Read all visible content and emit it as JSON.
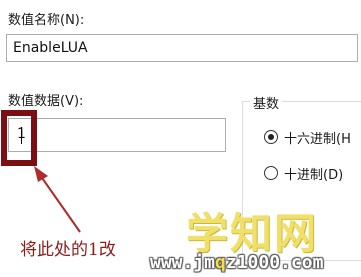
{
  "dialog": {
    "value_name_label": "数值名称(N):",
    "value_name": "EnableLUA",
    "value_data_label": "数值数据(V):",
    "value_data": "1",
    "base_label": "基数",
    "base_options": [
      {
        "label": "十六进制(H",
        "selected": true
      },
      {
        "label": "十进制(D)",
        "selected": false
      }
    ]
  },
  "annotation": {
    "text": "将此处的1改",
    "color": "#8b1d1d"
  },
  "watermark": {
    "main": "学知网",
    "url_prefix": "www.jm",
    "url_q": "q",
    "url_suffix": "z1000.com"
  },
  "colors": {
    "highlight_border": "#7b0e12",
    "arrow": "#b22a2a"
  }
}
